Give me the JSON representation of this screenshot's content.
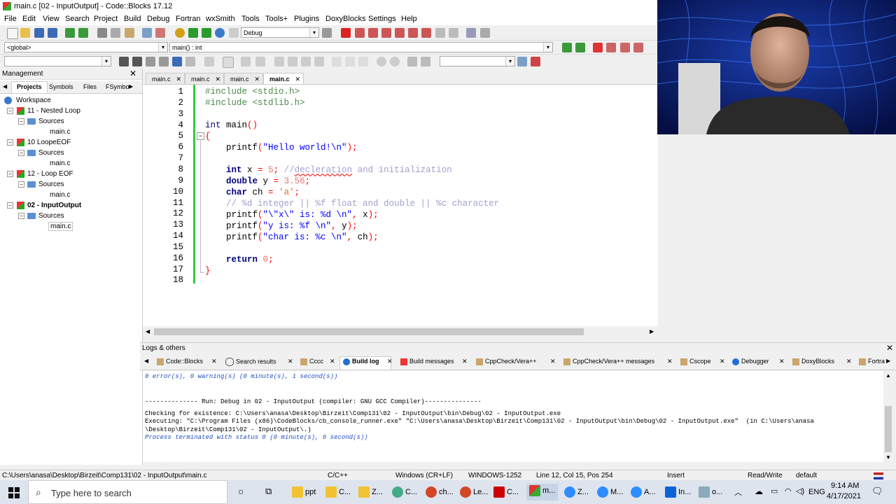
{
  "window": {
    "title": "main.c [02 - InputOutput] - Code::Blocks 17.12"
  },
  "menu": [
    "File",
    "Edit",
    "View",
    "Search",
    "Project",
    "Build",
    "Debug",
    "Fortran",
    "wxSmith",
    "Tools",
    "Tools+",
    "Plugins",
    "DoxyBlocks",
    "Settings",
    "Help"
  ],
  "toolbar": {
    "build_target": "Debug",
    "scope": "<global>",
    "function": "main() : int"
  },
  "management": {
    "title": "Management",
    "tabs": [
      "Projects",
      "Symbols",
      "Files",
      "FSymbo"
    ],
    "tree": {
      "workspace": "Workspace",
      "projects": [
        {
          "name": "11 - Nested Loop",
          "folder": "Sources",
          "file": "main.c",
          "bold": false
        },
        {
          "name": "10 LoopeEOF",
          "folder": "Sources",
          "file": "main.c",
          "bold": false
        },
        {
          "name": "12 - Loop EOF",
          "folder": "Sources",
          "file": "main.c",
          "bold": false
        },
        {
          "name": "02 - InputOutput",
          "folder": "Sources",
          "file": "main.c",
          "bold": true
        }
      ]
    }
  },
  "editor": {
    "tabs": [
      "main.c",
      "main.c",
      "main.c",
      "main.c"
    ],
    "active_tab": 3,
    "line_numbers": [
      "1",
      "2",
      "3",
      "4",
      "5",
      "6",
      "7",
      "8",
      "9",
      "10",
      "11",
      "12",
      "13",
      "14",
      "15",
      "16",
      "17",
      "18"
    ]
  },
  "logs": {
    "title": "Logs & others",
    "tabs": [
      "Code::Blocks",
      "Search results",
      "Cccc",
      "Build log",
      "Build messages",
      "CppCheck/Vera++",
      "CppCheck/Vera++ messages",
      "Cscope",
      "Debugger",
      "DoxyBlocks",
      "Fortra"
    ],
    "lines": [
      "0 error(s), 0 warning(s) (0 minute(s), 1 second(s))",
      "",
      "",
      "-------------- Run: Debug in 02 - InputOutput (compiler: GNU GCC Compiler)---------------",
      "",
      "Checking for existence: C:\\Users\\anasa\\Desktop\\Birzeit\\Comp131\\02 - InputOutput\\bin\\Debug\\02 - InputOutput.exe",
      "Executing: \"C:\\Program Files (x86)\\CodeBlocks/cb_console_runner.exe\" \"C:\\Users\\anasa\\Desktop\\Birzeit\\Comp131\\02 - InputOutput\\bin\\Debug\\02 - InputOutput.exe\"  (in C:\\Users\\anasa",
      "\\Desktop\\Birzeit\\Comp131\\02 - InputOutput\\.)",
      "Process terminated with status 0 (0 minute(s), 6 second(s))"
    ]
  },
  "status": {
    "path": "C:\\Users\\anasa\\Desktop\\Birzeit\\Comp131\\02 - InputOutput\\main.c",
    "language": "C/C++",
    "eol": "Windows (CR+LF)",
    "encoding": "WINDOWS-1252",
    "position": "Line 12, Col 15, Pos 254",
    "mode": "Insert",
    "access": "Read/Write",
    "profile": "default"
  },
  "taskbar": {
    "search_placeholder": "Type here to search",
    "apps": [
      "ppt",
      "C...",
      "Z...",
      "C...",
      "ch...",
      "Le...",
      "C...",
      "m...",
      "Z...",
      "M...",
      "A...",
      "In...",
      "o..."
    ],
    "lang": "ENG",
    "time": "9:14 AM",
    "date": "4/17/2021"
  },
  "colors": {
    "accent": "#0a64d8",
    "change_bar": "#2ecc40"
  }
}
